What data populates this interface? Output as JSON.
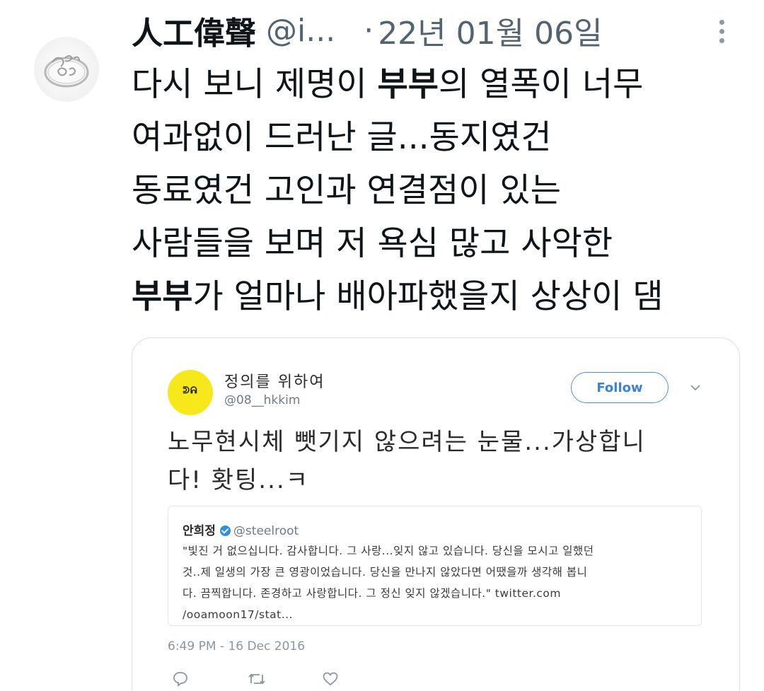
{
  "tweet": {
    "display_name": "人工偉聲",
    "handle": "@i...",
    "dot": "·",
    "timestamp": "22년 01월 06일",
    "lines": [
      {
        "pre": "다시 보니 제명이 ",
        "bold": "부부",
        "post": "의 열폭이 너무"
      },
      {
        "pre": "여과없이 드러난 글...동지였건",
        "bold": "",
        "post": ""
      },
      {
        "pre": "동료였건 고인과 연결점이 있는",
        "bold": "",
        "post": ""
      },
      {
        "pre": "사람들을 보며 저 욕심 많고 사악한",
        "bold": "",
        "post": ""
      },
      {
        "pre": "",
        "bold": "부부",
        "post": "가 얼마나 배아파했을지 상상이 댐"
      }
    ],
    "avatar_icon": "ring-avatar-icon",
    "more_icon": "more-options-icon"
  },
  "embedded_tweet": {
    "name": "정의를 위하여",
    "handle": "@08__hkkim",
    "avatar_text": "ᕲᕱ",
    "follow_label": "Follow",
    "text_lines": [
      "노무현시체 뺏기지 않으려는 눈물...가상합니",
      "다! 홧팅...ㅋ"
    ],
    "quoted": {
      "name": "안희정",
      "handle": "@steelroot",
      "lines": [
        "\"빛진 거 없으십니다. 감사합니다. 그 사랑...잊지 않고 있습니다. 당신을 모시고 일했던",
        "것..제 일생의 가장 큰 영광이었습니다. 당신을 만나지 않았다면 어땠을까 생각해 봅니",
        "다. 끔찍합니다. 존경하고 사랑합니다. 그 정신 잊지 않겠습니다.\" twitter.com",
        "/ooamoon17/stat..."
      ]
    },
    "date": "6:49 PM - 16 Dec 2016",
    "actions": [
      "reply-icon",
      "retweet-icon",
      "like-icon"
    ]
  },
  "colors": {
    "text": "#0f1419",
    "muted": "#536471",
    "follow_blue": "#3b84d4",
    "avatar_yellow": "#f6e81a"
  }
}
